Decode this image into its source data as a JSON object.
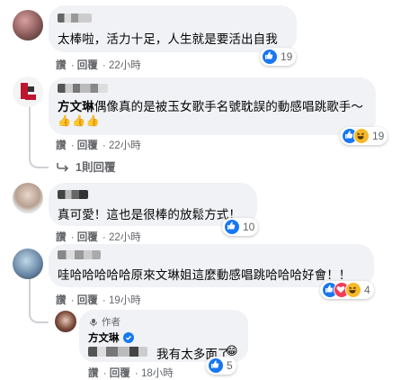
{
  "comments": [
    {
      "name": "",
      "text": "太棒啦，活力十足，人生就是要活出自我",
      "actions": [
        "讚",
        "回覆",
        "22小時"
      ],
      "reaction_count": "19",
      "reactions": [
        "like"
      ]
    },
    {
      "name": "",
      "text_highlight": "方文琳",
      "text": "偶像真的是被玉女歌手名號耽誤的動感唱跳歌手～",
      "emoji_line": "👍👍👍",
      "actions": [
        "讚",
        "回覆",
        "22小時"
      ],
      "reaction_count": "19",
      "reactions": [
        "like",
        "haha"
      ],
      "replies_link": "1則回覆"
    },
    {
      "name": "",
      "text": "真可愛！這也是很棒的放鬆方式！",
      "actions": [
        "讚",
        "回覆",
        "22小時"
      ],
      "reaction_count": "10",
      "reactions": [
        "like"
      ]
    },
    {
      "name": "",
      "text": "哇哈哈哈哈哈原來文琳姐這麼動感唱跳哈哈哈好會！！",
      "actions": [
        "讚",
        "回覆",
        "19小時"
      ],
      "reaction_count": "4",
      "reactions": [
        "like",
        "love",
        "haha"
      ]
    }
  ],
  "reply": {
    "author_badge": "作者",
    "name": "方文琳",
    "text": "我有太多面了",
    "emoji": "😁",
    "actions": [
      "讚",
      "回覆",
      "18小時"
    ],
    "reaction_count": "5",
    "reactions": [
      "like"
    ]
  },
  "colors": {
    "bubble": "#f0f2f5",
    "like_blue": "#1877f2",
    "meta_gray": "#65676b",
    "thread_line": "#ced0d4"
  }
}
